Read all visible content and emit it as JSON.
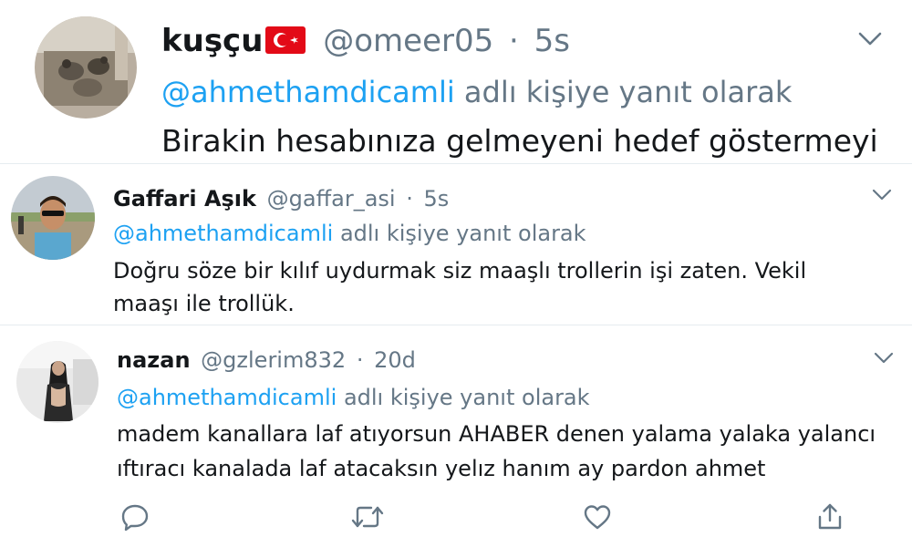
{
  "tweets": [
    {
      "name": "kuşçu",
      "flag": "turkey-flag",
      "handle": "@omeer05",
      "sep": "·",
      "time": "5s",
      "mention": "@ahmethamdicamli",
      "reply_suffix": "adlı kişiye yanıt olarak",
      "text_lines": [
        "Birakin hesabınıza gelmeyeni hedef göstermeyi"
      ]
    },
    {
      "name": "Gaffari Aşık",
      "handle": "@gaffar_asi",
      "sep": "·",
      "time": "5s",
      "mention": "@ahmethamdicamli",
      "reply_suffix": "adlı kişiye yanıt olarak",
      "text_lines": [
        "Doğru söze bir kılıf uydurmak siz maaşlı trollerin işi zaten. Vekil",
        "maaşı ile trollük."
      ]
    },
    {
      "name": "nazan",
      "handle": "@gzlerim832",
      "sep": "·",
      "time": "20d",
      "mention": "@ahmethamdicamli",
      "reply_suffix": "adlı kişiye yanıt olarak",
      "text_lines": [
        "madem kanallara laf atıyorsun AHABER  denen yalama yalaka yalancı",
        "ıftıracı kanalada laf atacaksın yelız hanım ay pardon ahmet"
      ]
    }
  ],
  "icons": {
    "more": "chevron-down-icon",
    "reply": "reply-icon",
    "retweet": "retweet-icon",
    "like": "like-icon",
    "share": "share-icon"
  },
  "colors": {
    "link": "#1da1f2",
    "muted": "#657786",
    "text": "#14171a",
    "flag_red": "#e30a17"
  }
}
